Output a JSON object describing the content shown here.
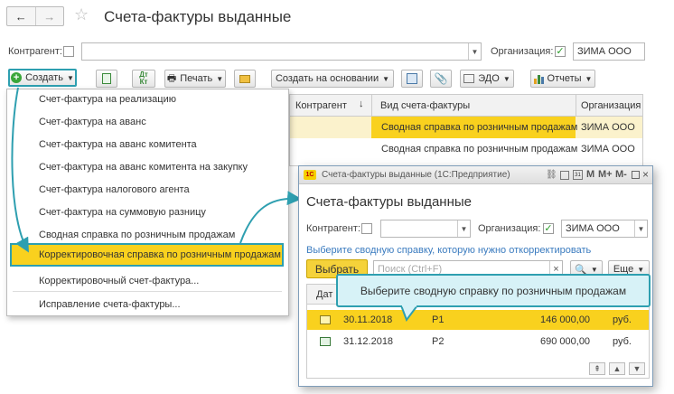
{
  "main": {
    "title": "Счета-фактуры выданные",
    "counterparty_label": "Контрагент:",
    "organization_label": "Организация:",
    "organization_value": "ЗИМА ООО",
    "toolbar": {
      "create": "Создать",
      "print": "Печать",
      "create_based": "Создать на основании",
      "edo": "ЭДО",
      "reports": "Отчеты",
      "dt_kt": "Дт\nКт"
    },
    "table": {
      "headers": [
        "Контрагент",
        "Вид счета-фактуры",
        "Организация"
      ],
      "rows": [
        {
          "kind": "Сводная справка по розничным продажам",
          "org": "ЗИМА ООО"
        },
        {
          "kind": "Сводная справка по розничным продажам",
          "org": "ЗИМА ООО"
        }
      ]
    }
  },
  "create_menu": {
    "items": [
      "Счет-фактура на реализацию",
      "Счет-фактура на аванс",
      "Счет-фактура на аванс комитента",
      "Счет-фактура на аванс комитента на закупку",
      "Счет-фактура налогового агента",
      "Счет-фактура на суммовую разницу",
      "Сводная справка по розничным продажам",
      "Корректировочная справка по розничным продажам",
      "Корректировочный счет-фактура...",
      "Исправление счета-фактуры..."
    ]
  },
  "dialog": {
    "window_title": "Счета-фактуры выданные  (1С:Предприятие)",
    "title": "Счета-фактуры выданные",
    "counterparty_label": "Контрагент:",
    "organization_label": "Организация:",
    "organization_value": "ЗИМА ООО",
    "hint": "Выберите сводную справку, которую нужно откорректировать",
    "select_button": "Выбрать",
    "search_placeholder": "Поиск (Ctrl+F)",
    "more_button": "Еще",
    "header_date": "Дат",
    "tooltip": "Выберите сводную справку по розничным продажам",
    "rows": [
      {
        "date": "30.11.2018",
        "number": "Р1",
        "amount": "146 000,00",
        "currency": "руб."
      },
      {
        "date": "31.12.2018",
        "number": "Р2",
        "amount": "690 000,00",
        "currency": "руб."
      }
    ],
    "title_buttons": [
      "M",
      "M+",
      "M-"
    ]
  },
  "colors": {
    "accent_teal": "#2e9fb0",
    "highlight_yellow": "#f9d11e",
    "select_yellow": "#f5d23a",
    "create_icon_green": "#3aa63a"
  }
}
